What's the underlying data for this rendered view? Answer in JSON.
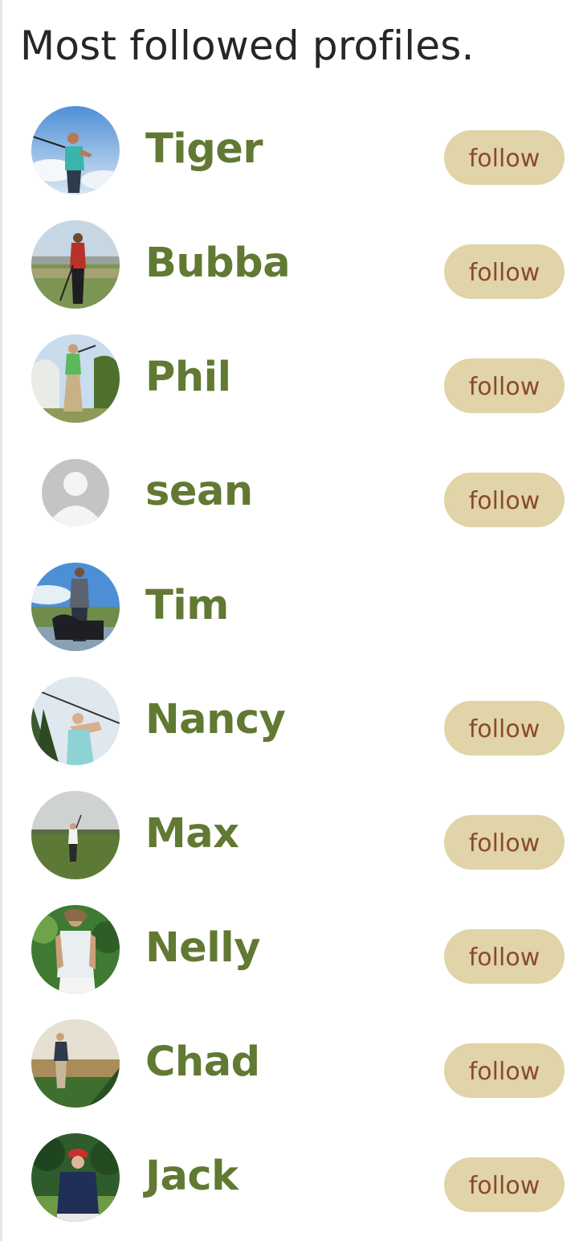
{
  "header": {
    "title": "Most followed profiles."
  },
  "profiles": [
    {
      "name": "Tiger",
      "follow_label": "follow",
      "show_follow": true,
      "avatar": "golfer-photo"
    },
    {
      "name": "Bubba",
      "follow_label": "follow",
      "show_follow": true,
      "avatar": "golfer-photo"
    },
    {
      "name": "Phil",
      "follow_label": "follow",
      "show_follow": true,
      "avatar": "golfer-photo"
    },
    {
      "name": "sean",
      "follow_label": "follow",
      "show_follow": true,
      "avatar": "default-user-icon"
    },
    {
      "name": "Tim",
      "follow_label": "",
      "show_follow": false,
      "avatar": "golfer-photo"
    },
    {
      "name": "Nancy",
      "follow_label": "follow",
      "show_follow": true,
      "avatar": "golfer-photo"
    },
    {
      "name": "Max",
      "follow_label": "follow",
      "show_follow": true,
      "avatar": "golfer-photo"
    },
    {
      "name": "Nelly",
      "follow_label": "follow",
      "show_follow": true,
      "avatar": "golfer-photo"
    },
    {
      "name": "Chad",
      "follow_label": "follow",
      "show_follow": true,
      "avatar": "golfer-photo"
    },
    {
      "name": "Jack",
      "follow_label": "follow",
      "show_follow": true,
      "avatar": "golfer-photo"
    }
  ],
  "colors": {
    "name_text": "#617932",
    "follow_bg": "#e0d4a8",
    "follow_text": "#8b4a2c",
    "title_text": "#24272a"
  }
}
